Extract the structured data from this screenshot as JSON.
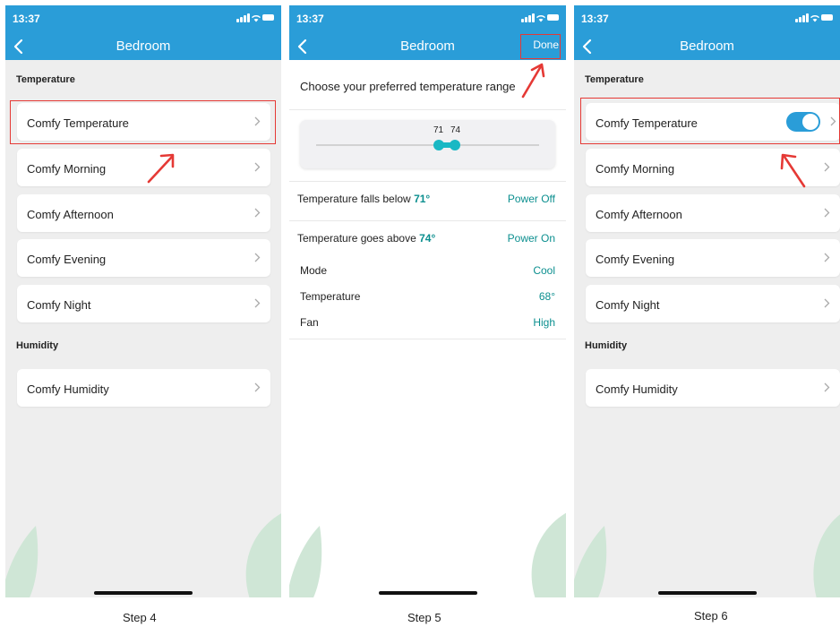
{
  "status_time": "13:37",
  "accent_color": "#2a9dd8",
  "value_color": "#0c8f8f",
  "highlight_color": "#e53935",
  "screens": {
    "step4": {
      "caption": "Step 4",
      "title": "Bedroom",
      "temperature_section": "Temperature",
      "temperature_items": [
        "Comfy Temperature",
        "Comfy Morning",
        "Comfy Afternoon",
        "Comfy Evening",
        "Comfy Night"
      ],
      "humidity_section": "Humidity",
      "humidity_items": [
        "Comfy Humidity"
      ]
    },
    "step5": {
      "caption": "Step 5",
      "title": "Bedroom",
      "done_label": "Done",
      "prompt": "Choose your preferred temperature range",
      "range_low": "71",
      "range_high": "74",
      "below_label": "Temperature falls below ",
      "below_value": "71°",
      "below_action": "Power Off",
      "above_label": "Temperature goes above ",
      "above_value": "74°",
      "above_action": "Power On",
      "details": [
        {
          "label": "Mode",
          "value": "Cool"
        },
        {
          "label": "Temperature",
          "value": "68°"
        },
        {
          "label": "Fan",
          "value": "High"
        }
      ]
    },
    "step6": {
      "caption": "Step 6",
      "title": "Bedroom",
      "temperature_section": "Temperature",
      "temperature_items": [
        "Comfy Temperature",
        "Comfy Morning",
        "Comfy Afternoon",
        "Comfy Evening",
        "Comfy Night"
      ],
      "toggle_on": true,
      "humidity_section": "Humidity",
      "humidity_items": [
        "Comfy Humidity"
      ]
    }
  }
}
